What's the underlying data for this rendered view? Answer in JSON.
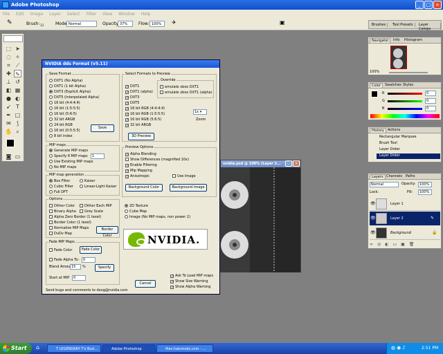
{
  "app": {
    "title": "Adobe Photoshop"
  },
  "menu": [
    "File",
    "Edit",
    "Image",
    "Layer",
    "Select",
    "Filter",
    "View",
    "Window",
    "Help"
  ],
  "options_bar": {
    "brush_label": "Brush:",
    "brush_size": "13",
    "mode_label": "Mode:",
    "mode_value": "Normal",
    "opacity_label": "Opacity:",
    "opacity_value": "37%",
    "flow_label": "Flow:",
    "flow_value": "100%"
  },
  "palette_well": [
    "Brushes",
    "Tool Presets",
    "Layer Comps"
  ],
  "dialog": {
    "title": "NVIDIA dds Format (v5.11)",
    "save_format": {
      "label": "Save Format",
      "options": [
        "DXT1 (No Alpha)",
        "DXT1 (1 bit Alpha)",
        "DXT3 (Explicit Alpha)",
        "DXT5 (Interpolated Alpha)",
        "16 bit (4:4:4:4)",
        "16 bit (1:5:5:5)",
        "16 bit (5:6:5)",
        "32 bit ARGB",
        "24 bit RGB",
        "16 bit (0:5:5:5)",
        "8 bit index"
      ],
      "selected": 2,
      "save_button": "Save"
    },
    "select_formats": {
      "label": "Select Formats to Preview",
      "items": [
        "DXT1",
        "DXT1 (alpha)",
        "DXT3",
        "DXT5",
        "16 bit RGB (4:4:4:4)",
        "16 bit RGB (1:5:5:5)",
        "16 bit RGB (5:6:5)",
        "32 bit ARGB"
      ],
      "override_label": "Override",
      "override": [
        "emulate xbox DXT1",
        "emulate xbox DXT1 (alpha)"
      ],
      "zoom_value": "1x",
      "zoom_label": "Zoom",
      "preview_button": "3D Preview"
    },
    "mip_maps": {
      "label": "MIP maps",
      "options": [
        "Generate MIP maps",
        "Specify  8 MIP maps",
        "Use Existing MIP maps",
        "No MIP maps"
      ],
      "specify_value": "1"
    },
    "preview_options": {
      "label": "Preview Options",
      "items": [
        "Alpha Blending",
        "Show Differences (magnified 10x)",
        "Enable Filtering",
        "Mip Mapping",
        "Anisotropic"
      ],
      "use_image": "Use Image",
      "bg_color_button": "Background Color",
      "bg_image_button": "Background Image"
    },
    "mip_generation": {
      "label": "MIP map generation",
      "options": [
        "Box Filter",
        "Kaiser",
        "Cubic Filter",
        "Linear-Light Kaiser",
        "Full DFT"
      ]
    },
    "options": {
      "label": "Options",
      "items": [
        "Dither Color",
        "Dither Each MIP",
        "Binary Alpha",
        "Grey Scale",
        "Alpha Zero Border (1 texel)",
        "Border Color (1 texel)",
        "Normalize MIP Maps",
        "DuDv Map"
      ],
      "border_color_button": "Border Color"
    },
    "texture_type": [
      "2D Texture",
      "Cube Map",
      "Image (No MIP maps, non power 2)"
    ],
    "fade": {
      "label": "Fade MIP Maps",
      "fade_color_check": "Fade Color",
      "fade_color_button": "Fade Color",
      "fade_alpha": "Fade Alpha To:",
      "fade_alpha_value": "0",
      "blend_label": "Blend Amount",
      "blend_value": "15",
      "blend_unit": "%",
      "specify_button": "Specify",
      "start_label": "Start at MIP",
      "start_value": "0"
    },
    "ask": [
      "Ask To Load MIP maps",
      "Show Size Warning",
      "Show Alpha Warning"
    ],
    "cancel_button": "Cancel",
    "footer": "Send bugs and comments to doug@nvidia.com",
    "brand": "NVIDIA."
  },
  "image_window": {
    "title": "nvidia.psd @ 100% (Layer 2..."
  },
  "navigator": {
    "tabs": [
      "Navigator",
      "Info",
      "Histogram"
    ],
    "zoom": "100%"
  },
  "color_panel": {
    "tabs": [
      "Color",
      "Swatches",
      "Styles"
    ],
    "channels": [
      "R",
      "G",
      "B"
    ],
    "values": [
      "0",
      "0",
      "0"
    ]
  },
  "history": {
    "tabs": [
      "History",
      "Actions"
    ],
    "items": [
      "Rectangular Marquee",
      "Brush Tool",
      "Layer Order",
      "Layer Order"
    ]
  },
  "layers": {
    "tabs": [
      "Layers",
      "Channels",
      "Paths"
    ],
    "blend": "Normal",
    "opacity_label": "Opacity:",
    "opacity": "100%",
    "lock_label": "Lock:",
    "fill_label": "Fill:",
    "fill": "100%",
    "items": [
      "Layer 1",
      "Layer 2",
      "Background"
    ],
    "selected": 1
  },
  "taskbar": {
    "start": "Start",
    "tasks": [
      "T LEGENDARY T's Bud...",
      "Adobe Photoshop",
      "files.halomods.com - ..."
    ],
    "clock": "2:51 PM"
  }
}
